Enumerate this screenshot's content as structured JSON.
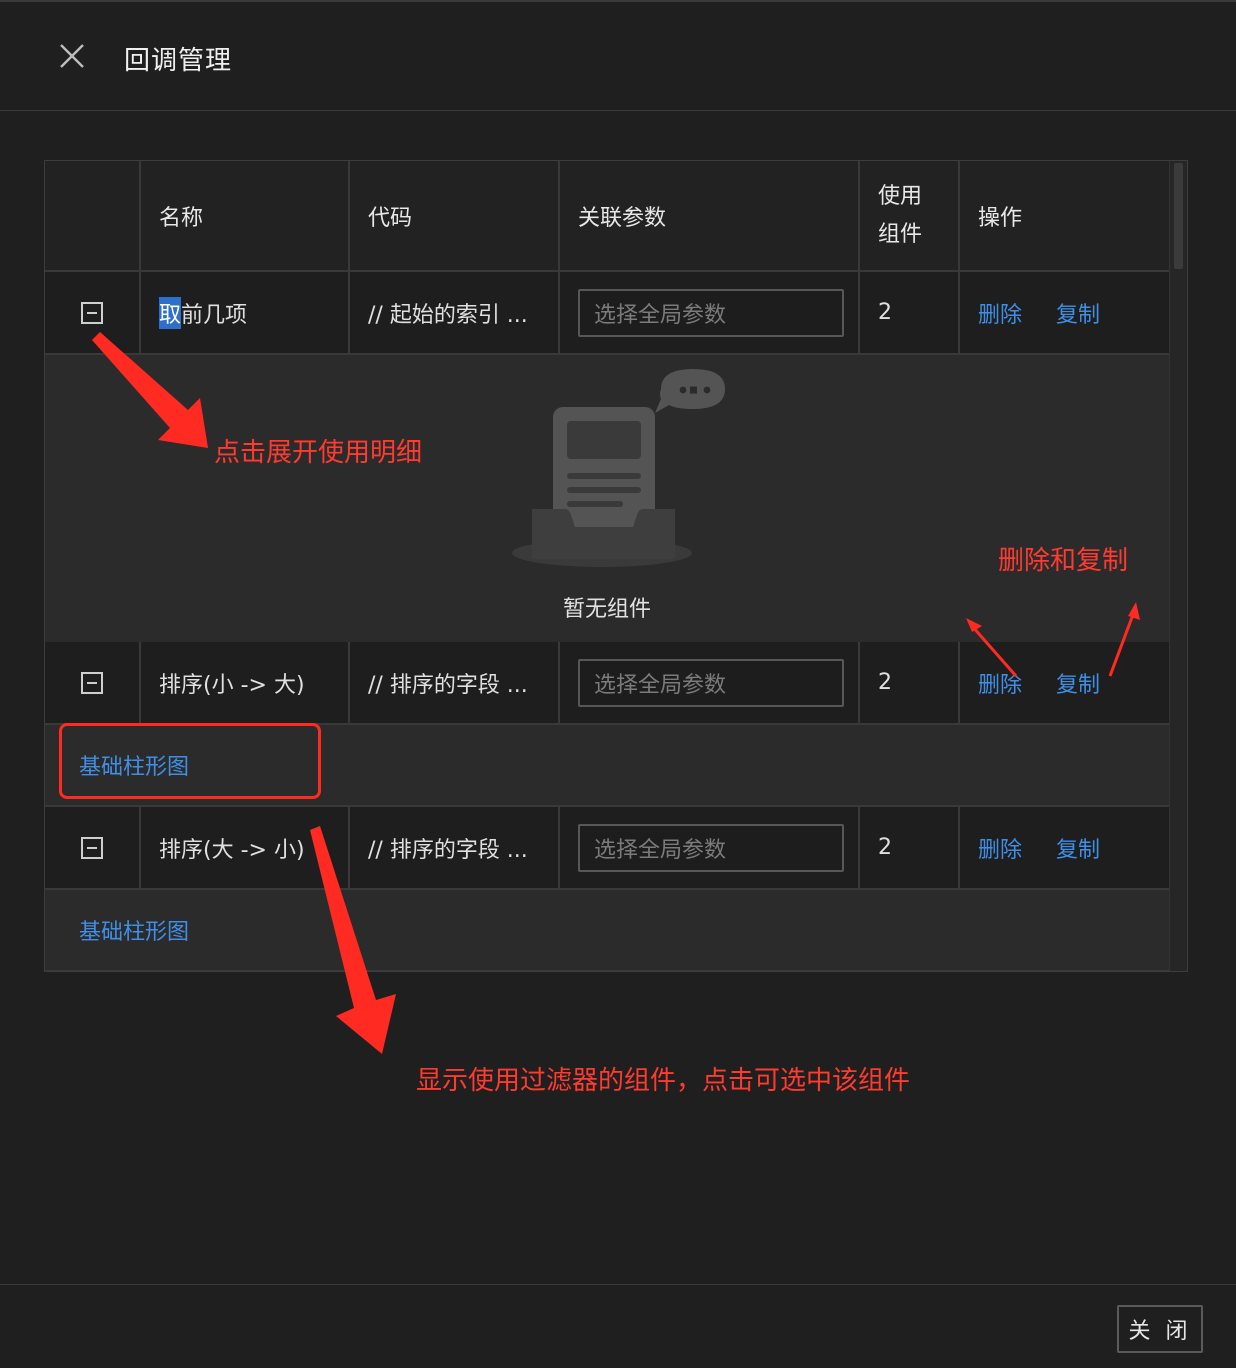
{
  "dialog": {
    "title": "回调管理",
    "close_button": "关 闭"
  },
  "table": {
    "headers": {
      "name": "名称",
      "code": "代码",
      "params": "关联参数",
      "usage_line1": "使用",
      "usage_line2": "组件",
      "actions": "操作"
    },
    "rows": [
      {
        "name_highlight": "取",
        "name_rest": "前几项",
        "code": "// 起始的索引 ...",
        "param_placeholder": "选择全局参数",
        "usage": "2",
        "delete": "删除",
        "copy": "复制",
        "expanded_empty_text": "暂无组件"
      },
      {
        "name": "排序(小 -> 大)",
        "code": "// 排序的字段 ...",
        "param_placeholder": "选择全局参数",
        "usage": "2",
        "delete": "删除",
        "copy": "复制",
        "component": "基础柱形图"
      },
      {
        "name": "排序(大 -> 小)",
        "code": "// 排序的字段 ...",
        "param_placeholder": "选择全局参数",
        "usage": "2",
        "delete": "删除",
        "copy": "复制",
        "component": "基础柱形图"
      }
    ]
  },
  "annotations": {
    "expand_hint": "点击展开使用明细",
    "delete_copy_hint": "删除和复制",
    "component_hint": "显示使用过滤器的组件，点击可选中该组件"
  },
  "colors": {
    "annotation": "#ff3b30",
    "link": "#3f8fe6",
    "background": "#1f1f20"
  }
}
